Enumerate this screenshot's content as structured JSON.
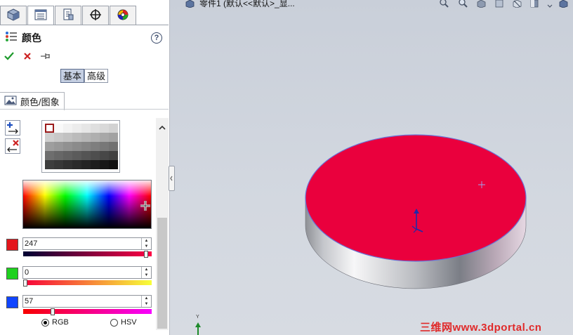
{
  "panel": {
    "tabs": [
      {
        "name": "feature-manager",
        "icon": "part-cube-icon"
      },
      {
        "name": "property-manager",
        "icon": "property-list-icon",
        "active": true
      },
      {
        "name": "configuration-manager",
        "icon": "configuration-icon"
      },
      {
        "name": "dimxpert-manager",
        "icon": "crosshair-icon"
      },
      {
        "name": "display-manager",
        "icon": "color-wheel-icon"
      }
    ],
    "title": "颜色",
    "help_icon": "?",
    "actions": {
      "ok_icon": "check-icon",
      "cancel_icon": "close-icon",
      "pin_icon": "pushpin-icon"
    },
    "mode_buttons": {
      "basic": "基本",
      "advanced": "高级",
      "selected": "basic"
    },
    "group_title": "颜色/图象",
    "color": {
      "channels": [
        {
          "value": "247",
          "chip_color": "#e4161c",
          "fraction": 0.97,
          "gradient_from": "#000033",
          "gradient_to": "#ff0044"
        },
        {
          "value": "0",
          "chip_color": "#1fd11f",
          "fraction": 0.0,
          "gradient_from": "#f70039",
          "gradient_to": "#f7ff39"
        },
        {
          "value": "57",
          "chip_color": "#1045ff",
          "fraction": 0.22,
          "gradient_from": "#f70000",
          "gradient_to": "#f700ff"
        }
      ],
      "models": {
        "rgb": "RGB",
        "hsv": "HSV",
        "selected": "rgb"
      }
    }
  },
  "viewport": {
    "tree_label": "零件1 (默认<<默认>_显...",
    "part_face_color": "#ea003d",
    "watermark": "三维网www.3dportal.cn",
    "axis_label": "Y"
  }
}
